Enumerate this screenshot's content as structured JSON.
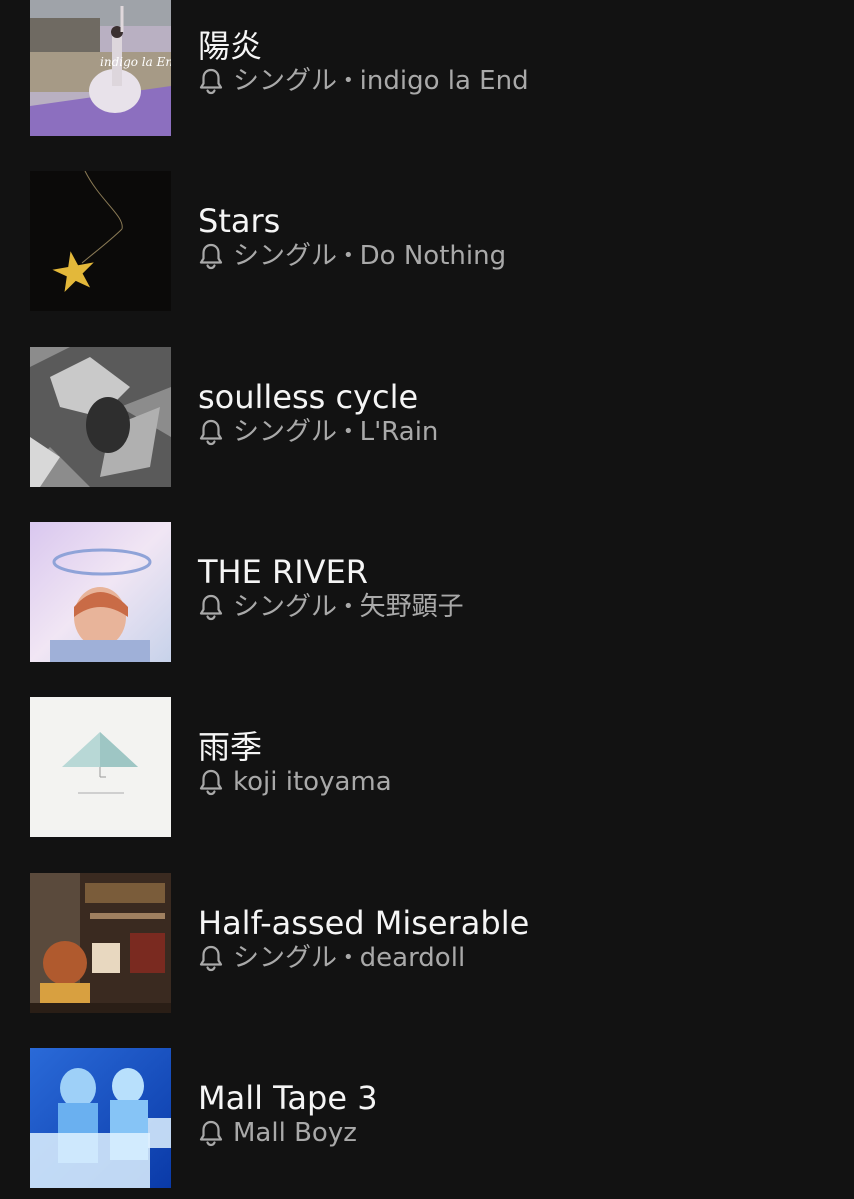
{
  "colors": {
    "background": "#121212",
    "title": "#f5f5f5",
    "subtitle": "#a9a9a9"
  },
  "items": [
    {
      "title": "陽炎",
      "type": "シングル",
      "artist": "indigo la End",
      "icon": "bell-icon"
    },
    {
      "title": "Stars",
      "type": "シングル",
      "artist": "Do Nothing",
      "icon": "bell-icon"
    },
    {
      "title": "soulless cycle",
      "type": "シングル",
      "artist": "L'Rain",
      "icon": "bell-icon"
    },
    {
      "title": "THE RIVER",
      "type": "シングル",
      "artist": "矢野顕子",
      "icon": "bell-icon"
    },
    {
      "title": "雨季",
      "type": "",
      "artist": "koji itoyama",
      "icon": "bell-icon"
    },
    {
      "title": "Half-assed Miserable",
      "type": "シングル",
      "artist": "deardoll",
      "icon": "bell-icon"
    },
    {
      "title": "Mall Tape 3",
      "type": "",
      "artist": "Mall Boyz",
      "icon": "bell-icon"
    }
  ],
  "separator": "•"
}
